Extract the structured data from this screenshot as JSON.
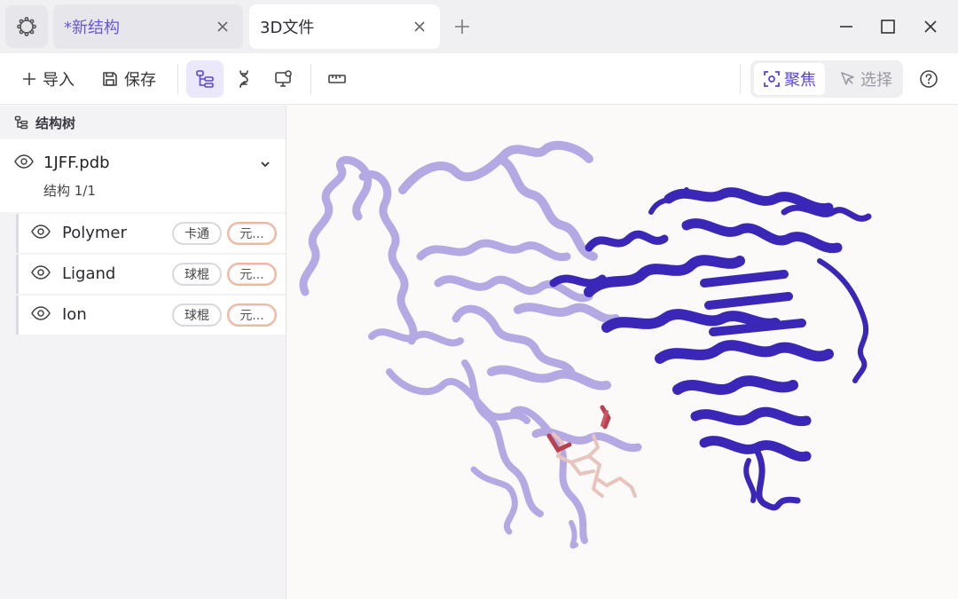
{
  "window": {
    "tabs": [
      {
        "label": "*新结构",
        "active": false
      },
      {
        "label": "3D文件",
        "active": true
      }
    ],
    "icons": {
      "app": "app-logo-icon",
      "new_tab": "plus-icon",
      "minimize": "minimize-icon",
      "maximize": "maximize-icon",
      "close": "close-icon"
    }
  },
  "toolbar": {
    "import_label": "导入",
    "save_label": "保存",
    "tools": [
      "structure-tree-icon",
      "dna-icon",
      "display-settings-icon",
      "ruler-icon"
    ],
    "mode_focus": "聚焦",
    "mode_select": "选择",
    "active_mode": "focus",
    "accent_color": "#5a45d4"
  },
  "sidebar": {
    "title": "结构树",
    "file": {
      "name": "1JFF.pdb",
      "subtitle": "结构 1/1"
    },
    "components": [
      {
        "name": "Polymer",
        "representation": "卡通",
        "color": "元..."
      },
      {
        "name": "Ligand",
        "representation": "球棍",
        "color": "元..."
      },
      {
        "name": "Ion",
        "representation": "球棍",
        "color": "元..."
      }
    ]
  },
  "viewer": {
    "colors": {
      "chain_a": "#a99be0",
      "chain_b": "#3a27b8",
      "ligand": "#b8404f",
      "ligand_light": "#e8c4bd"
    }
  }
}
